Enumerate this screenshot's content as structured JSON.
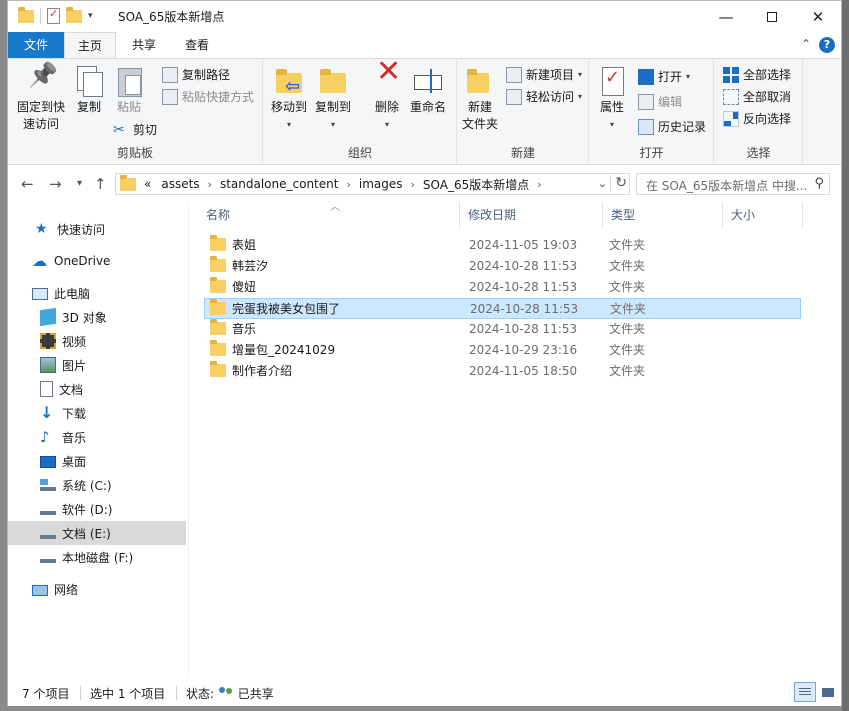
{
  "window": {
    "title": "SOA_65版本新增点",
    "min_glyph": "—",
    "close_glyph": "✕"
  },
  "ribbon_tabs": {
    "file": "文件",
    "home": "主页",
    "share": "共享",
    "view": "查看",
    "help": "?"
  },
  "ribbon": {
    "clipboard": {
      "label": "剪贴板",
      "pin": [
        "固定到快",
        "速访问"
      ],
      "copy": "复制",
      "paste": "粘贴",
      "copy_path": "复制路径",
      "paste_shortcut": "粘贴快捷方式",
      "cut": "剪切"
    },
    "organize": {
      "label": "组织",
      "move_to": "移动到",
      "copy_to": "复制到",
      "delete": "删除",
      "rename": "重命名"
    },
    "new": {
      "label": "新建",
      "new_folder": [
        "新建",
        "文件夹"
      ],
      "new_item": "新建项目",
      "easy_access": "轻松访问"
    },
    "open": {
      "label": "打开",
      "properties": "属性",
      "open": "打开",
      "edit": "编辑",
      "history": "历史记录"
    },
    "select": {
      "label": "选择",
      "select_all": "全部选择",
      "select_none": "全部取消",
      "invert": "反向选择"
    }
  },
  "address": {
    "overflow": "«",
    "crumbs": [
      "assets",
      "standalone_content",
      "images",
      "SOA_65版本新增点"
    ],
    "search_placeholder": "在 SOA_65版本新增点 中搜..."
  },
  "sidebar": {
    "items": [
      {
        "label": "快速访问",
        "icon": "star-icon"
      },
      {
        "label": "OneDrive",
        "icon": "cloud-icon"
      },
      {
        "label": "此电脑",
        "icon": "computer-icon"
      },
      {
        "label": "3D 对象",
        "icon": "cube-icon"
      },
      {
        "label": "视频",
        "icon": "video-icon"
      },
      {
        "label": "图片",
        "icon": "picture-icon"
      },
      {
        "label": "文档",
        "icon": "document-icon"
      },
      {
        "label": "下载",
        "icon": "download-icon"
      },
      {
        "label": "音乐",
        "icon": "music-icon"
      },
      {
        "label": "桌面",
        "icon": "desktop-icon"
      },
      {
        "label": "系统 (C:)",
        "icon": "drive-icon"
      },
      {
        "label": "软件 (D:)",
        "icon": "drive-icon"
      },
      {
        "label": "文档 (E:)",
        "icon": "drive-icon"
      },
      {
        "label": "本地磁盘 (F:)",
        "icon": "drive-icon"
      },
      {
        "label": "网络",
        "icon": "network-icon"
      }
    ],
    "selected_index": 12
  },
  "columns": {
    "name": "名称",
    "date": "修改日期",
    "type": "类型",
    "size": "大小"
  },
  "files": [
    {
      "name": "表姐",
      "date": "2024-11-05 19:03",
      "type": "文件夹"
    },
    {
      "name": "韩芸汐",
      "date": "2024-10-28 11:53",
      "type": "文件夹"
    },
    {
      "name": "傻妞",
      "date": "2024-10-28 11:53",
      "type": "文件夹"
    },
    {
      "name": "完蛋我被美女包围了",
      "date": "2024-10-28 11:53",
      "type": "文件夹"
    },
    {
      "name": "音乐",
      "date": "2024-10-28 11:53",
      "type": "文件夹"
    },
    {
      "name": "增量包_20241029",
      "date": "2024-10-29 23:16",
      "type": "文件夹"
    },
    {
      "name": "制作者介绍",
      "date": "2024-11-05 18:50",
      "type": "文件夹"
    }
  ],
  "selected_file_index": 3,
  "status": {
    "count": "7 个项目",
    "selected": "选中 1 个项目",
    "state_label": "状态:",
    "state_value": "已共享"
  },
  "colors": {
    "accent": "#1979ca",
    "selection": "#cce8ff",
    "folder": "#f7cf62"
  }
}
